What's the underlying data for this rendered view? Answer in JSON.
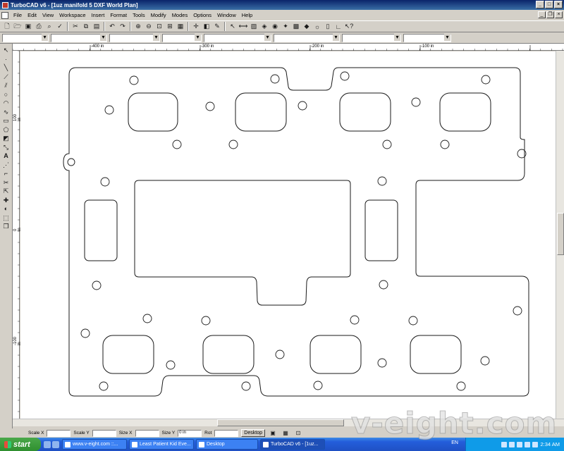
{
  "window": {
    "title": "TurboCAD v6 - [1uz manifold 5 DXF World Plan]",
    "min": "_",
    "max": "□",
    "close": "×"
  },
  "menu": [
    "File",
    "Edit",
    "View",
    "Workspace",
    "Insert",
    "Format",
    "Tools",
    "Modify",
    "Modes",
    "Options",
    "Window",
    "Help"
  ],
  "toolbar_icons": [
    "new-icon",
    "open-icon",
    "save-icon",
    "print-icon",
    "print-preview-icon",
    "spell-icon",
    "cut-icon",
    "copy-icon",
    "paste-icon",
    "undo-icon",
    "redo-icon",
    "zoom-in-icon",
    "zoom-out-icon",
    "zoom-window-icon",
    "zoom-extents-icon",
    "redraw-icon",
    "snap-icon",
    "layer-icon",
    "brush-icon",
    "pointer-icon",
    "dimension-icon",
    "hatch-icon",
    "render-icon",
    "view-icon",
    "camera-icon",
    "grid-icon",
    "block-icon",
    "light-icon",
    "page-icon",
    "help-cursor-icon"
  ],
  "ruler": {
    "h_labels": [
      "-400 in",
      "-300 in",
      "-200 in",
      "-100 in"
    ],
    "v_labels": [
      "100 in",
      "0 in",
      "-100 in"
    ]
  },
  "status": {
    "scale_x_label": "Scale X",
    "scale_y_label": "Scale Y",
    "size_x_label": "Size X",
    "size_y_label": "Size Y",
    "size_y_value": "0 in",
    "rot_label": "Rot",
    "tab_label": "Desktop"
  },
  "taskbar": {
    "start": "start",
    "tasks": [
      "www.v-eight.com ::...",
      "Least Patient Kid Eve...",
      "Desktop",
      "TurboCAD v6 - [1uz..."
    ],
    "lang": "EN",
    "clock": "2:34 AM"
  },
  "watermark": "v-eight.com"
}
